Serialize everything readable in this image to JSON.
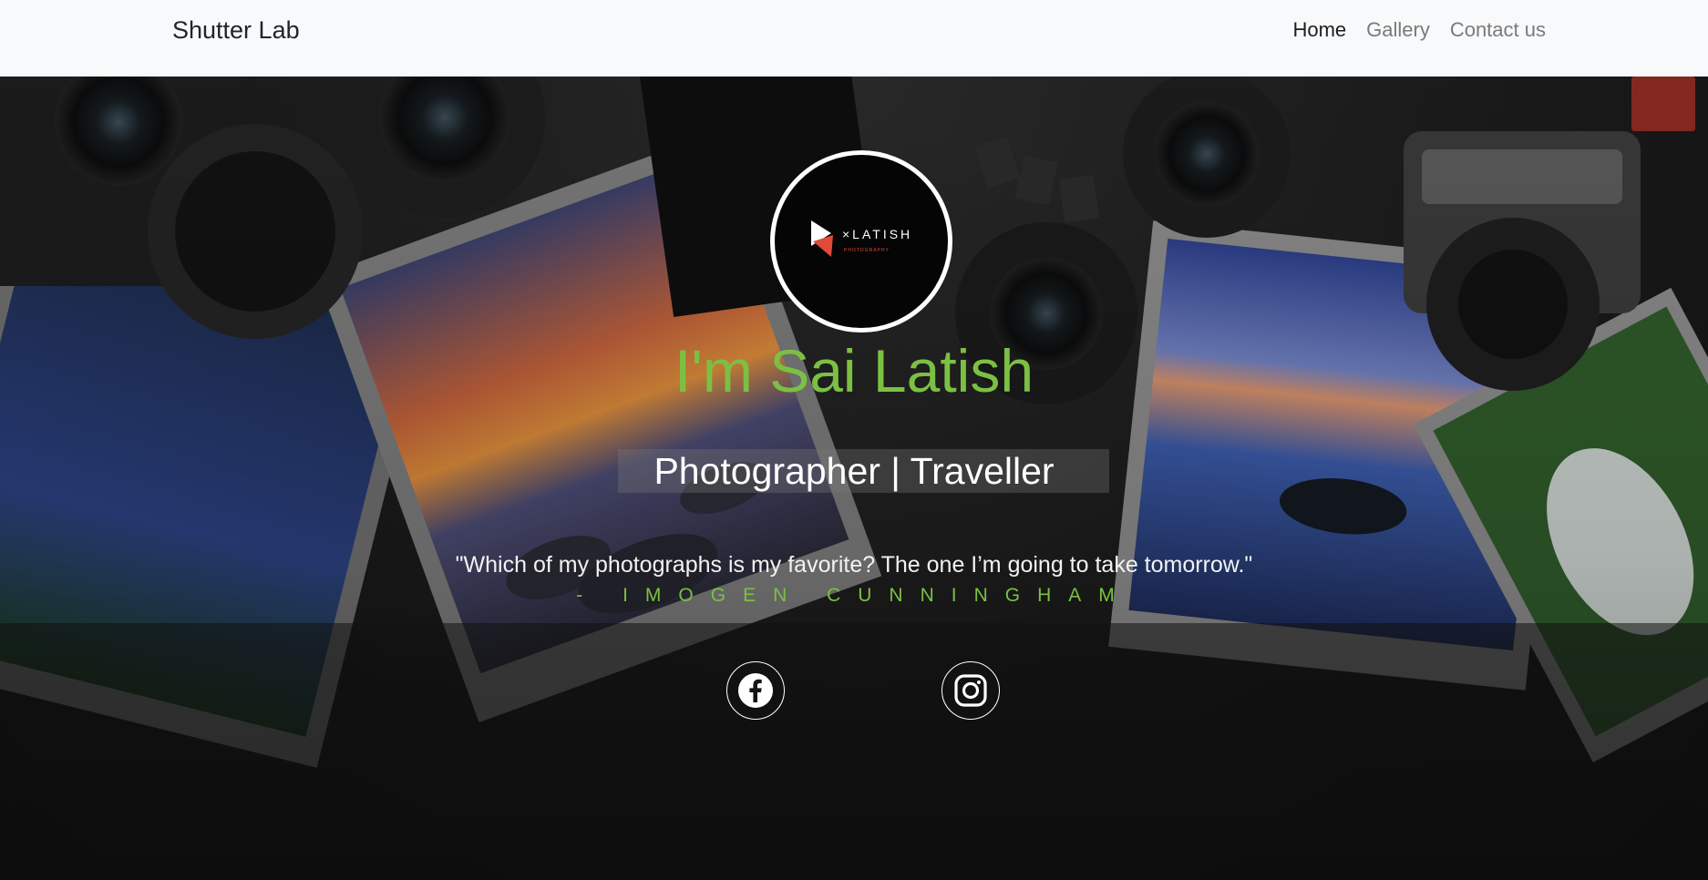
{
  "navbar": {
    "brand": "Shutter Lab",
    "links": [
      {
        "label": "Home",
        "active": true
      },
      {
        "label": "Gallery",
        "active": false
      },
      {
        "label": "Contact us",
        "active": false
      }
    ]
  },
  "hero": {
    "logo": {
      "wordmark": "×LATISH",
      "tagline": "PHOTOGRAPHY"
    },
    "title": "I'm Sai Latish",
    "subtitle": "Photographer | Traveller",
    "quote": "\"Which of my photographs is my favorite? The one I’m going to take tomorrow.\"",
    "author": "- IMOGEN CUNNINGHAM",
    "social": [
      {
        "icon": "facebook-icon"
      },
      {
        "icon": "instagram-icon"
      }
    ]
  },
  "colors": {
    "accent": "#7cc043",
    "navbar_bg": "#f8f9fa",
    "hero_bg": "#1a1a1a",
    "text_light": "#ffffff"
  }
}
